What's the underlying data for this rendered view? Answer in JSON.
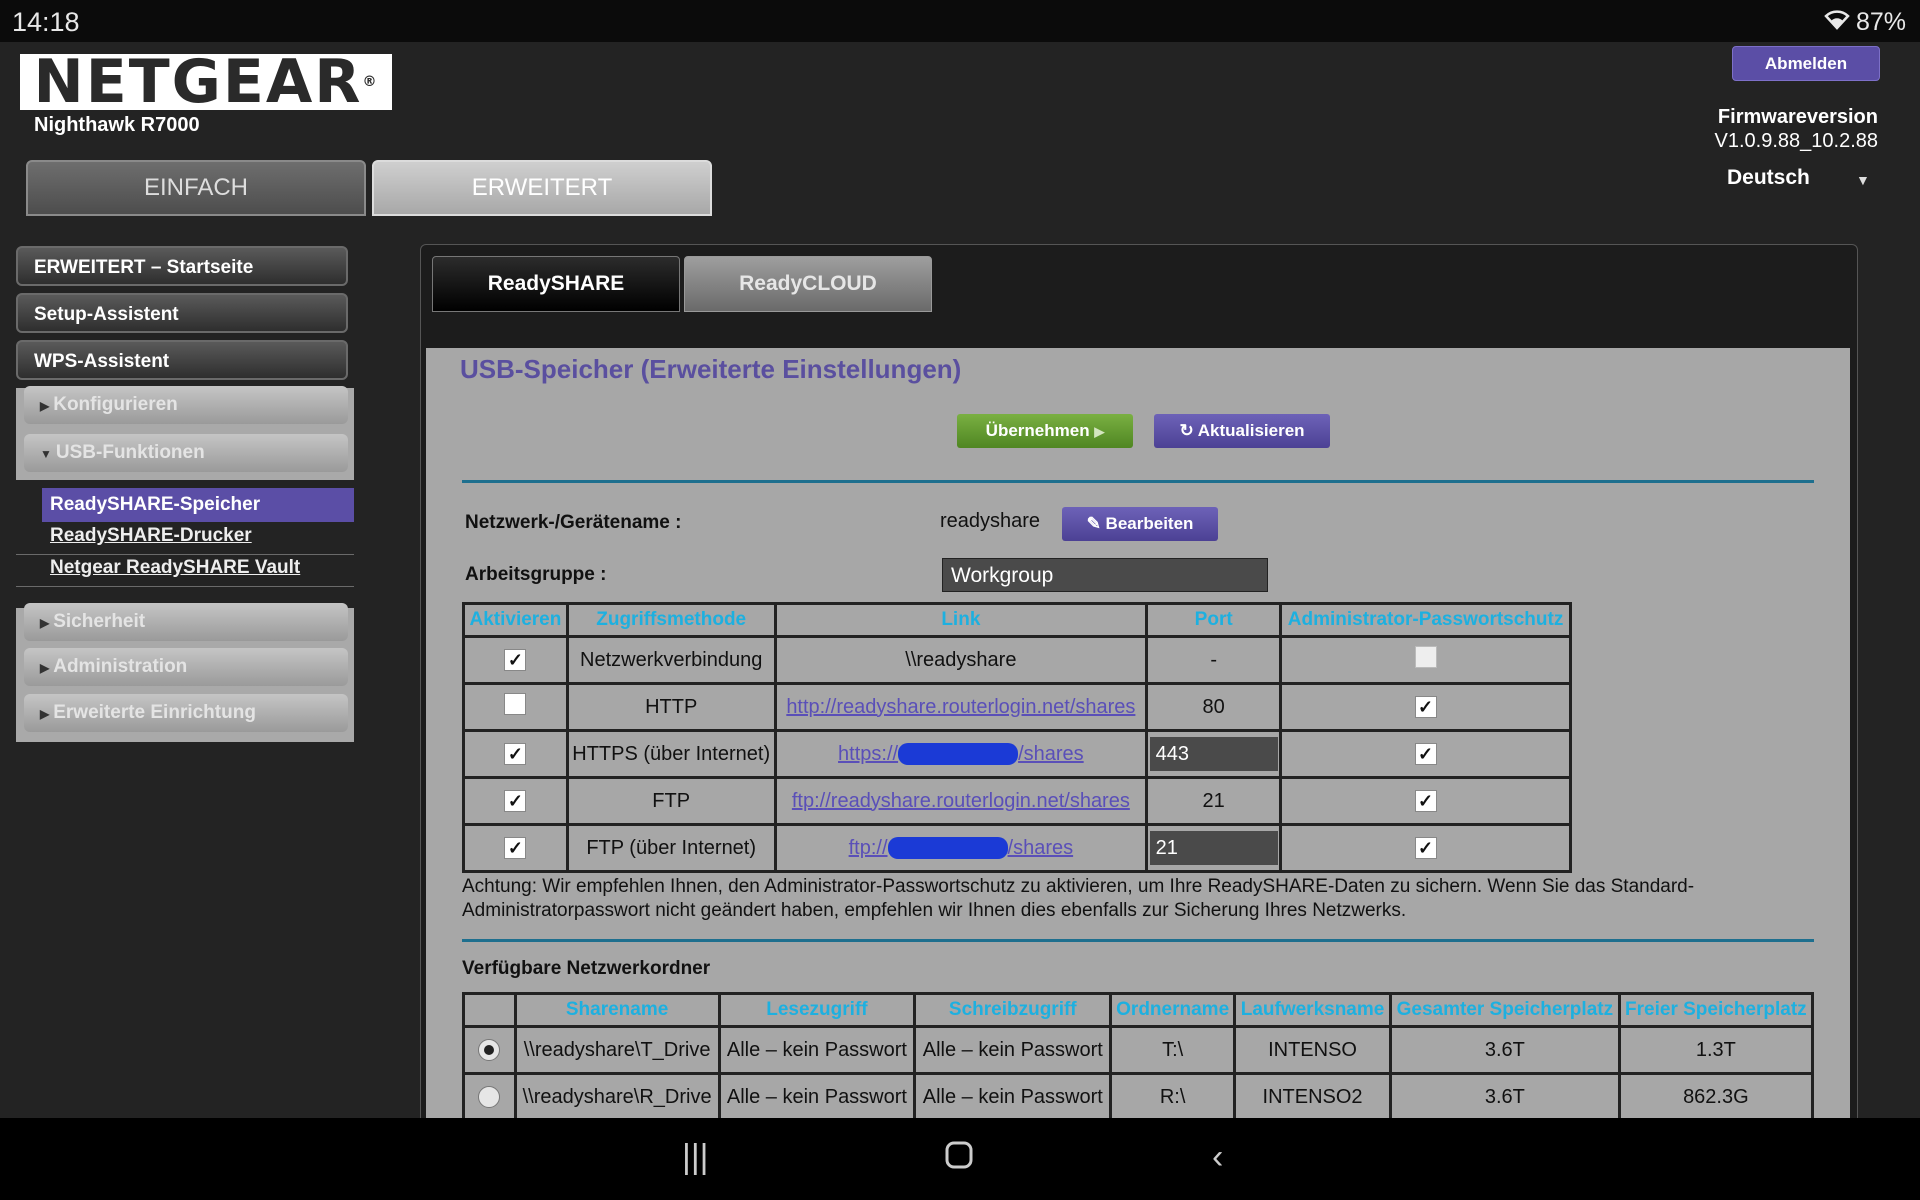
{
  "status_bar": {
    "time": "14:18",
    "battery": "87%"
  },
  "header": {
    "logo": "NETGEAR",
    "model": "Nighthawk R7000",
    "logout": "Abmelden",
    "firmware_label": "Firmwareversion",
    "firmware_value": "V1.0.9.88_10.2.88",
    "language": "Deutsch",
    "tabs": [
      "EINFACH",
      "ERWEITERT"
    ]
  },
  "sidebar": {
    "main_items": [
      "ERWEITERT – Startseite",
      "Setup-Assistent",
      "WPS-Assistent"
    ],
    "group1": [
      "Konfigurieren",
      "USB-Funktionen"
    ],
    "usb_sub": [
      "ReadySHARE-Speicher",
      "ReadySHARE-Drucker",
      "Netgear ReadySHARE Vault"
    ],
    "group2": [
      "Sicherheit",
      "Administration",
      "Erweiterte Einrichtung"
    ]
  },
  "main": {
    "subtabs": [
      "ReadySHARE",
      "ReadyCLOUD"
    ],
    "title": "USB-Speicher (Erweiterte Einstellungen)",
    "apply": "Übernehmen",
    "refresh": "Aktualisieren",
    "device_name_label": "Netzwerk-/Gerätename :",
    "device_name": "readyshare",
    "edit": "Bearbeiten",
    "workgroup_label": "Arbeitsgruppe :",
    "workgroup": "Workgroup",
    "access_headers": [
      "Aktivieren",
      "Zugriffsmethode",
      "Link",
      "Port",
      "Administrator-Passwortschutz"
    ],
    "access_rows": [
      {
        "method": "Netzwerkverbindung",
        "link": "\\\\readyshare",
        "port": "-"
      },
      {
        "method": "HTTP",
        "link": "http://readyshare.routerlogin.net/shares",
        "port": "80"
      },
      {
        "method": "HTTPS (über Internet)",
        "link_prefix": "https://",
        "link_suffix": "/shares",
        "port": "443"
      },
      {
        "method": "FTP",
        "link": "ftp://readyshare.routerlogin.net/shares",
        "port": "21"
      },
      {
        "method": "FTP (über Internet)",
        "link_prefix": "ftp://",
        "link_suffix": "/shares",
        "port": "21"
      }
    ],
    "warning": "Achtung: Wir empfehlen Ihnen, den Administrator-Passwortschutz zu aktivieren, um Ihre ReadySHARE-Daten zu sichern. Wenn Sie das Standard-Administratorpasswort nicht geändert haben, empfehlen wir Ihnen dies ebenfalls zur Sicherung Ihres Netzwerks.",
    "folders_title": "Verfügbare Netzwerkordner",
    "folder_headers": [
      "Sharename",
      "Lesezugriff",
      "Schreibzugriff",
      "Ordnername",
      "Laufwerksname",
      "Gesamter Speicherplatz",
      "Freier Speicherplatz"
    ],
    "folder_rows": [
      [
        "\\\\readyshare\\T_Drive",
        "Alle – kein Passwort",
        "Alle – kein Passwort",
        "T:\\",
        "INTENSO",
        "3.6T",
        "1.3T"
      ],
      [
        "\\\\readyshare\\R_Drive",
        "Alle – kein Passwort",
        "Alle – kein Passwort",
        "R:\\",
        "INTENSO2",
        "3.6T",
        "862.3G"
      ]
    ]
  }
}
